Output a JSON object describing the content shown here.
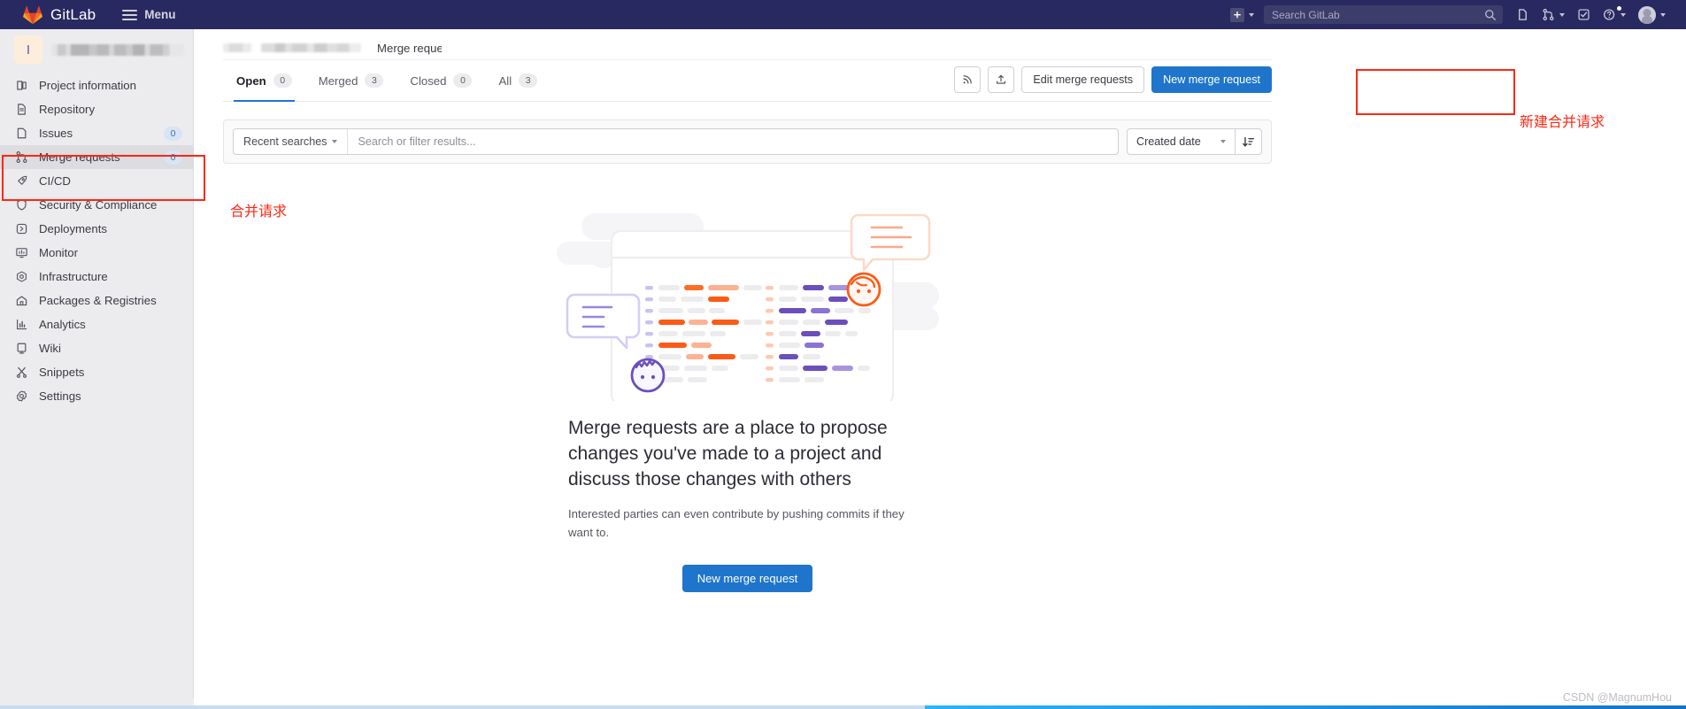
{
  "navbar": {
    "brand": "GitLab",
    "brand_logo_icon": "gitlab-tanuki-logo",
    "menu_label": "Menu",
    "search_placeholder": "Search GitLab",
    "search_value": "",
    "icons": {
      "plus": "plus-square-icon",
      "search": "search-icon",
      "issues": "issues-icon",
      "merge_requests": "merge-request-icon",
      "todos": "todo-check-icon",
      "help": "help-circle-icon",
      "avatar": "user-avatar"
    },
    "accent_bg": "#292961"
  },
  "sidebar": {
    "project_avatar_letter": "I",
    "project_name_redacted": "",
    "items": [
      {
        "label": "Project information",
        "icon": "project-information-icon",
        "badge": ""
      },
      {
        "label": "Repository",
        "icon": "repository-icon",
        "badge": ""
      },
      {
        "label": "Issues",
        "icon": "issues-icon",
        "badge": "0"
      },
      {
        "label": "Merge requests",
        "icon": "merge-request-icon",
        "badge": "0"
      },
      {
        "label": "CI/CD",
        "icon": "rocket-icon",
        "badge": ""
      },
      {
        "label": "Security & Compliance",
        "icon": "shield-icon",
        "badge": ""
      },
      {
        "label": "Deployments",
        "icon": "deployments-icon",
        "badge": ""
      },
      {
        "label": "Monitor",
        "icon": "monitor-icon",
        "badge": ""
      },
      {
        "label": "Infrastructure",
        "icon": "infrastructure-icon",
        "badge": ""
      },
      {
        "label": "Packages & Registries",
        "icon": "package-icon",
        "badge": ""
      },
      {
        "label": "Analytics",
        "icon": "analytics-chart-icon",
        "badge": ""
      },
      {
        "label": "Wiki",
        "icon": "wiki-book-icon",
        "badge": ""
      },
      {
        "label": "Snippets",
        "icon": "snippet-scissors-icon",
        "badge": ""
      },
      {
        "label": "Settings",
        "icon": "gear-icon",
        "badge": ""
      }
    ],
    "active_index": 3
  },
  "breadcrumb": {
    "current": "Merge request"
  },
  "tabs": [
    {
      "label": "Open",
      "count": "0",
      "active": true
    },
    {
      "label": "Merged",
      "count": "3",
      "active": false
    },
    {
      "label": "Closed",
      "count": "0",
      "active": false
    },
    {
      "label": "All",
      "count": "3",
      "active": false
    }
  ],
  "toolbar": {
    "rss_icon": "rss-feed-icon",
    "export_icon": "export-upload-icon",
    "edit_label": "Edit merge requests",
    "new_label": "New merge request",
    "primary_color": "#1f75cb"
  },
  "filter_bar": {
    "recent_searches_label": "Recent searches",
    "search_placeholder": "Search or filter results...",
    "search_value": "",
    "sort_value": "Created date",
    "sort_direction_icon": "sort-descending-icon"
  },
  "empty_state": {
    "illustration_name": "merge-request-empty-illustration",
    "title": "Merge requests are a place to propose changes you've made to a project and discuss those changes with others",
    "description": "Interested parties can even contribute by pushing commits if they want to.",
    "cta_label": "New merge request"
  },
  "annotations": {
    "sidebar_note": "合并请求",
    "button_note": "新建合并请求",
    "color": "#fe2712"
  },
  "watermark": "CSDN @MagnumHou"
}
